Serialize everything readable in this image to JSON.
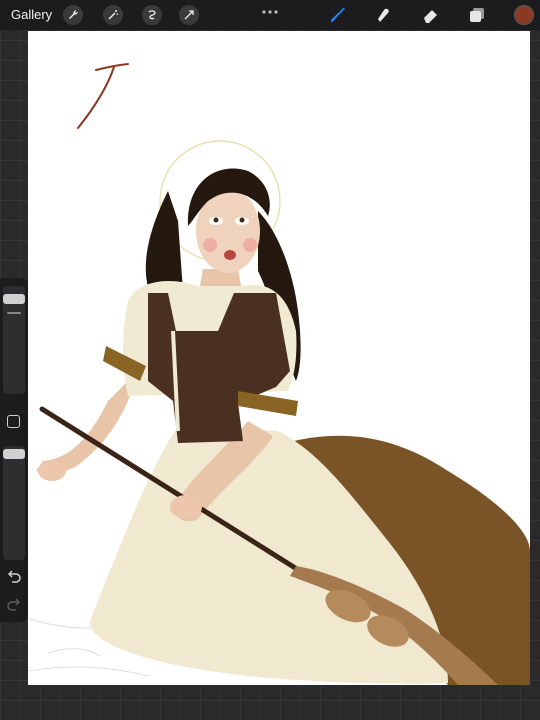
{
  "app": {
    "gallery_label": "Gallery"
  },
  "toolbar": {
    "left_tools": [
      "wrench-icon",
      "magic-wand-icon",
      "selection-icon",
      "transform-icon"
    ],
    "right_tools": [
      "brush-icon",
      "smudge-icon",
      "eraser-icon",
      "layers-icon"
    ],
    "active_tool": "brush-icon",
    "active_color": "#8a3a22",
    "accent_color": "#1f8bff"
  },
  "sidebar": {
    "controls": [
      "brush-size-slider",
      "modify-button",
      "opacity-slider",
      "undo-button",
      "redo-button"
    ]
  },
  "canvas": {
    "background": "#ffffff",
    "content": "artwork"
  }
}
